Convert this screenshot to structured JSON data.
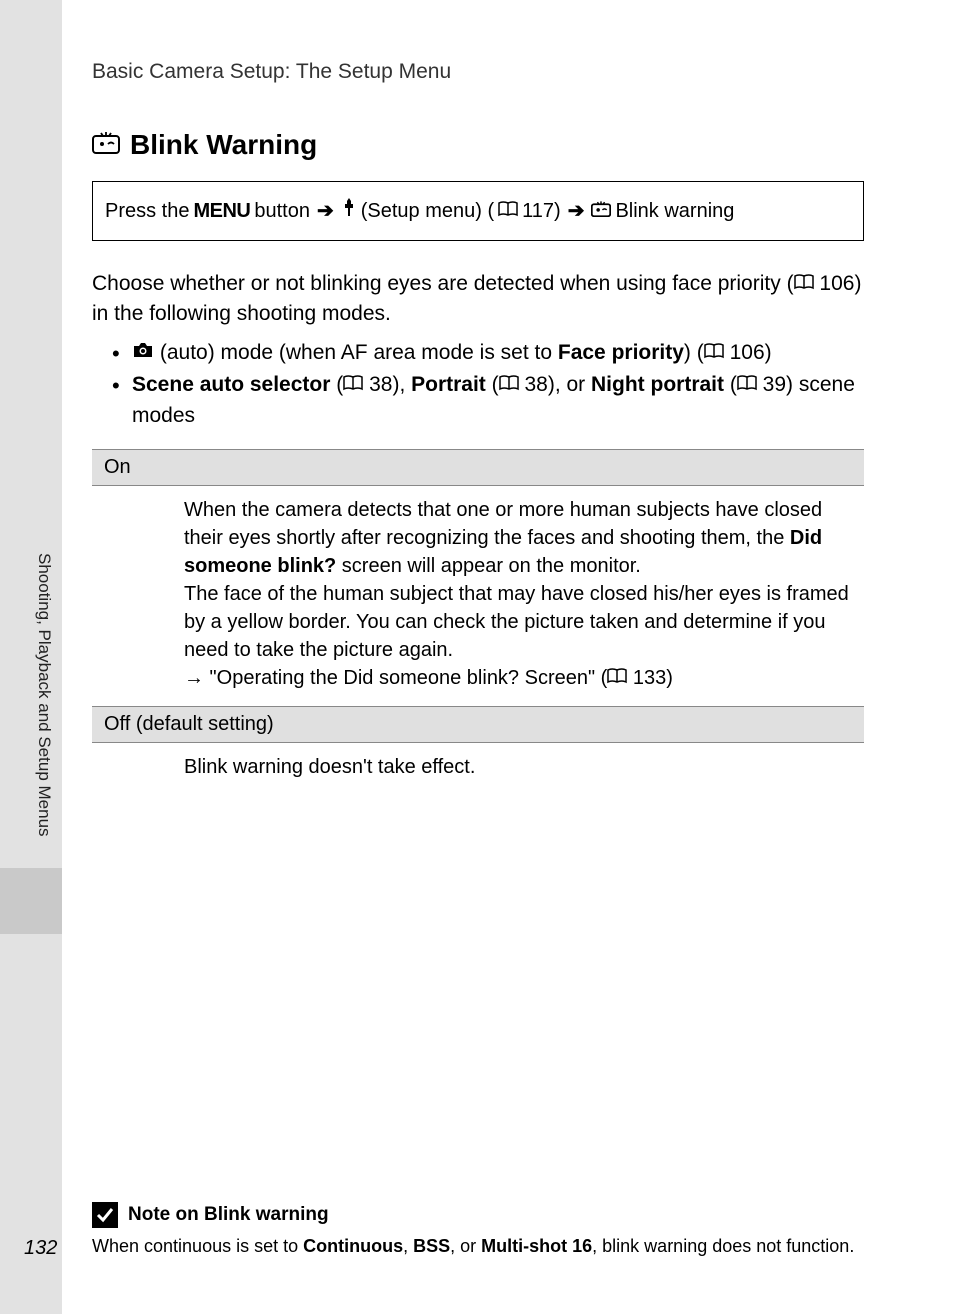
{
  "header": "Basic Camera Setup: The Setup Menu",
  "title": "Blink Warning",
  "nav": {
    "press": "Press the",
    "menu": "MENU",
    "button": "button",
    "setup": "(Setup menu) (",
    "p117": "117)",
    "blink": "Blink warning"
  },
  "intro1": "Choose whether or not blinking eyes are detected when using face priority (",
  "intro_p106": "106) in the following shooting modes.",
  "bullets": {
    "b1a": "(auto) mode (when AF area mode is set to ",
    "b1fp": "Face priority",
    "b1b": ") (",
    "b1p": "106)",
    "b2a": "Scene auto selector",
    "b2b": " (",
    "b2p1": "38), ",
    "b2c": "Portrait",
    "b2d": " (",
    "b2p2": "38), or ",
    "b2e": "Night portrait",
    "b2f": " (",
    "b2p3": "39) scene modes"
  },
  "options": {
    "on_label": "On",
    "on_body1": "When the camera detects that one or more human subjects have closed their eyes shortly after recognizing the faces and shooting them, the ",
    "on_bold": "Did someone blink?",
    "on_body2": " screen will appear on the monitor.",
    "on_body3": "The face of the human subject that may have closed his/her eyes is framed by a yellow border. You can check the picture taken and determine if you need to take the picture again.",
    "on_link": "→ \"Operating the Did someone blink? Screen\" (",
    "on_p": "133)",
    "off_label": "Off (default setting)",
    "off_body": "Blink warning doesn't take effect."
  },
  "side_label": "Shooting, Playback and Setup Menus",
  "note": {
    "title": "Note on Blink warning",
    "body1": "When continuous is set to ",
    "c": "Continuous",
    "sep1": ", ",
    "bss": "BSS",
    "sep2": ", or ",
    "ms": "Multi-shot 16",
    "body2": ", blink warning does not function."
  },
  "page_number": "132"
}
